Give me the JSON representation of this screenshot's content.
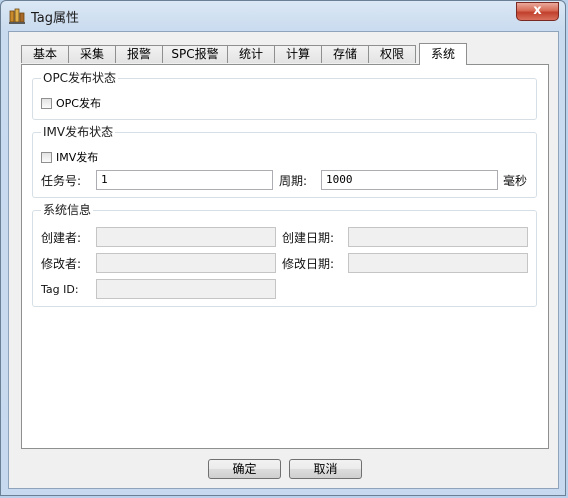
{
  "window": {
    "title": "Tag属性",
    "close_glyph": "x"
  },
  "tabs": [
    "基本",
    "采集",
    "报警",
    "SPC报警",
    "统计",
    "计算",
    "存储",
    "权限",
    "系统"
  ],
  "active_tab": "系统",
  "opc": {
    "legend": "OPC发布状态",
    "checkbox_label": "OPC发布",
    "checked": false
  },
  "imv": {
    "legend": "IMV发布状态",
    "checkbox_label": "IMV发布",
    "checked": false,
    "task_label": "任务号:",
    "task_value": "1",
    "period_label": "周期:",
    "period_value": "1000",
    "unit": "毫秒"
  },
  "sysinfo": {
    "legend": "系统信息",
    "creator_label": "创建者:",
    "creator_value": "",
    "create_date_label": "创建日期:",
    "create_date_value": "",
    "modifier_label": "修改者:",
    "modifier_value": "",
    "modify_date_label": "修改日期:",
    "modify_date_value": "",
    "tagid_label": "Tag ID:",
    "tagid_value": ""
  },
  "buttons": {
    "ok": "确定",
    "cancel": "取消"
  }
}
